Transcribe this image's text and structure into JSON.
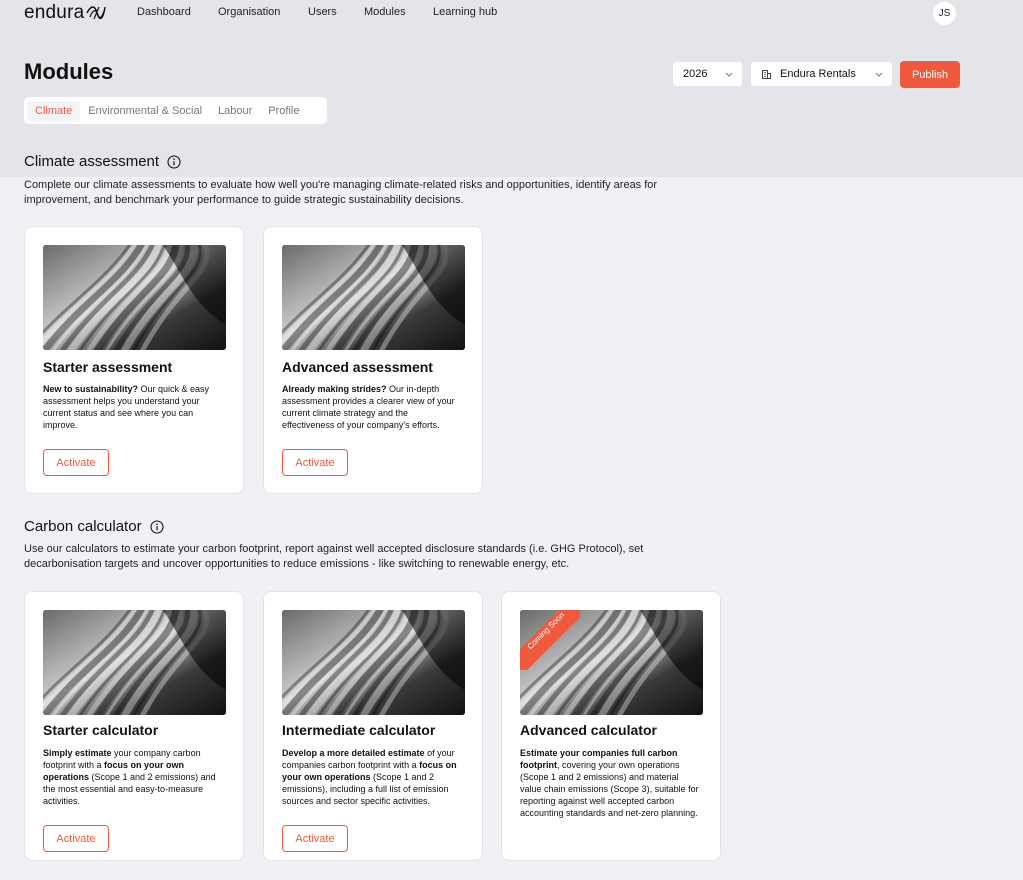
{
  "brand": {
    "logo_text": "endura",
    "accent": "#f0593b"
  },
  "nav": {
    "links": [
      "Dashboard",
      "Organisation",
      "Users",
      "Modules",
      "Learning hub"
    ],
    "avatar_initials": "JS"
  },
  "page": {
    "title": "Modules",
    "year_select": "2026",
    "org_select": "Endura Rentals",
    "publish_label": "Publish"
  },
  "tabs": [
    "Climate",
    "Environmental & Social",
    "Labour",
    "Profile"
  ],
  "active_tab": "Climate",
  "sections": [
    {
      "title": "Climate assessment",
      "description": "Complete our climate assessments to evaluate how well you're managing climate-related risks and opportunities, identify areas for improvement, and benchmark your performance to guide strategic sustainability decisions.",
      "cards": [
        {
          "title": "Starter assessment",
          "desc_bold": "New to sustainability?",
          "desc_rest": " Our quick & easy assessment helps you understand your current status and see where you can improve.",
          "button": "Activate"
        },
        {
          "title": "Advanced assessment",
          "desc_bold": "Already making strides?",
          "desc_rest": " Our in-depth assessment provides a clearer view of your current climate strategy and the effectiveness of your company's efforts.",
          "button": "Activate"
        }
      ]
    },
    {
      "title": "Carbon calculator",
      "description": "Use our calculators to estimate your carbon footprint, report against well accepted disclosure standards (i.e. GHG Protocol), set decarbonisation targets and uncover opportunities to reduce emissions - like switching to renewable energy, etc.",
      "cards": [
        {
          "title": "Starter calculator",
          "desc_p1_bold": "Simply estimate",
          "desc_p2": " your company carbon footprint with a ",
          "desc_p3_bold": "focus on your own operations",
          "desc_p4": " (Scope 1 and 2 emissions) and the most essential and easy-to-measure activities.",
          "button": "Activate"
        },
        {
          "title": "Intermediate calculator",
          "desc_p1_bold": "Develop a more detailed estimate",
          "desc_p2": " of your companies carbon footprint with a ",
          "desc_p3_bold": "focus on your own operations",
          "desc_p4": " (Scope 1 and 2 emissions), including a full list of emission sources and sector specific activities.",
          "button": "Activate"
        },
        {
          "title": "Advanced calculator",
          "desc_p1_bold": "Estimate your companies full carbon footprint",
          "desc_p2": ", covering your own operations (Scope 1 and 2 emissions) and material value chain emissions (Scope 3), suitable for reporting against well accepted carbon accounting standards and net-zero planning.",
          "ribbon": "Coming Soon"
        }
      ]
    }
  ]
}
